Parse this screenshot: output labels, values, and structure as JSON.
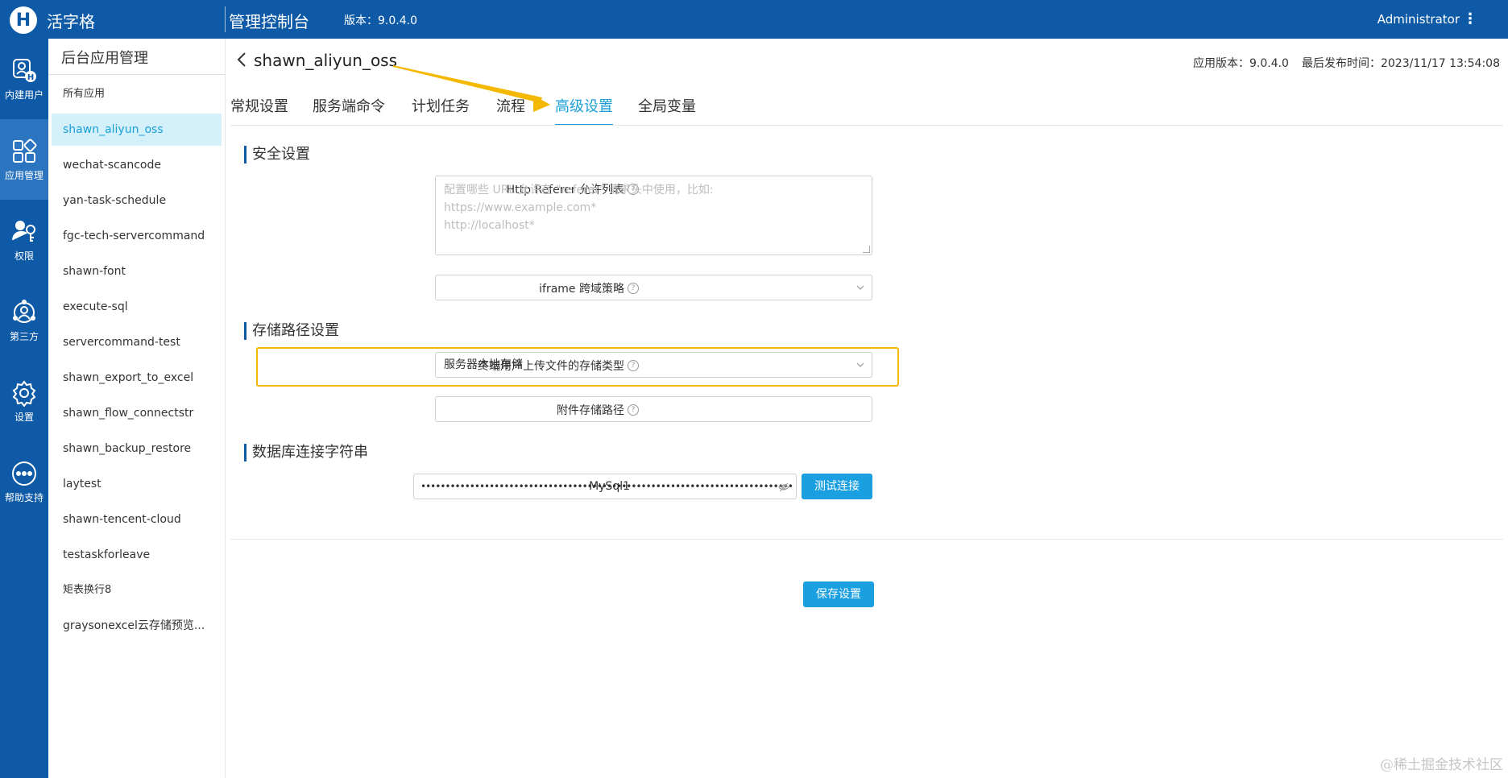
{
  "header": {
    "logo_letter": "H",
    "brand": "活字格",
    "console_title": "管理控制台",
    "version": "版本：9.0.4.0",
    "user": "Administrator",
    "more": "⋮"
  },
  "rail": {
    "items": [
      {
        "label": "内建用户",
        "icon": "users-icon"
      },
      {
        "label": "应用管理",
        "icon": "apps-icon",
        "active": true
      },
      {
        "label": "权限",
        "icon": "permission-icon"
      },
      {
        "label": "第三方",
        "icon": "third-party-icon"
      },
      {
        "label": "设置",
        "icon": "gear-icon"
      },
      {
        "label": "帮助支持",
        "icon": "more-circle-icon"
      }
    ]
  },
  "applist": {
    "title": "后台应用管理",
    "items": [
      "所有应用",
      "shawn_aliyun_oss",
      "wechat-scancode",
      "yan-task-schedule",
      "fgc-tech-servercommand",
      "shawn-font",
      "execute-sql",
      "servercommand-test",
      "shawn_export_to_excel",
      "shawn_flow_connectstr",
      "shawn_backup_restore",
      "laytest",
      "shawn-tencent-cloud",
      "testaskforleave",
      "矩表换行8",
      "graysonexcel云存储预览..."
    ],
    "active_index": 1
  },
  "main": {
    "title": "shawn_aliyun_oss",
    "app_version": "应用版本：9.0.4.0",
    "last_publish": "最后发布时间：2023/11/17 13:54:08",
    "tabs": [
      "常规设置",
      "服务端命令",
      "计划任务",
      "流程",
      "高级设置",
      "全局变量"
    ],
    "active_tab": 4,
    "security": {
      "title": "安全设置",
      "referer_label": "Http Referer 允许列表",
      "referer_placeholder_lines": [
        "配置哪些 URL 允许在 \"referer\" 请求头中使用，比如:",
        "https://www.example.com*",
        "http://localhost*"
      ],
      "iframe_label": "iframe 跨域策略",
      "iframe_value": ""
    },
    "storage": {
      "title": "存储路径设置",
      "type_label": "终端用户上传文件的存储类型",
      "type_value": "服务器本地存储",
      "path_label": "附件存储路径",
      "path_value": ""
    },
    "database": {
      "title": "数据库连接字符串",
      "mysql_label": "MySql1",
      "mysql_value": "••••••••••••••••••••••••••••••••••••••••••••••••••••••••••••••••••••••••••••",
      "test_button": "测试连接"
    },
    "save_button": "保存设置",
    "help_glyph": "?"
  },
  "watermark": "@稀土掘金技术社区",
  "colors": {
    "primary": "#0e5aa7",
    "accent": "#1a9fd8",
    "highlight": "#f5b800"
  }
}
